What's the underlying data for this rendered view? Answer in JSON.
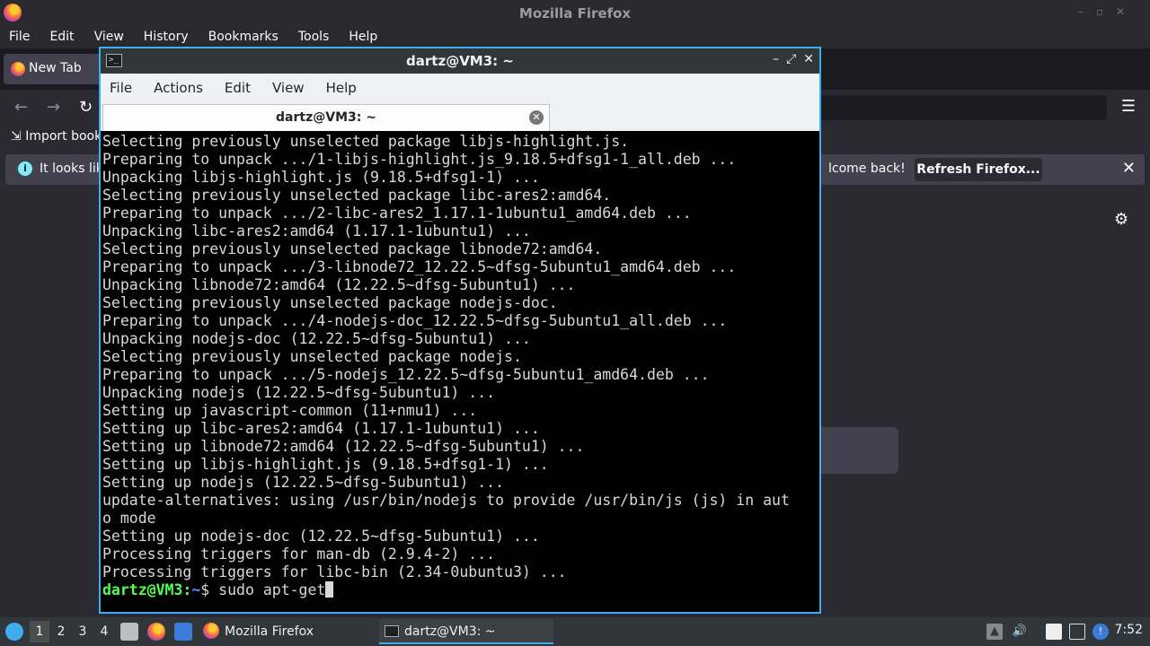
{
  "firefox": {
    "window_title": "Mozilla Firefox",
    "menu": [
      "File",
      "Edit",
      "View",
      "History",
      "Bookmarks",
      "Tools",
      "Help"
    ],
    "tab_label": "New Tab",
    "bookmarks_item": "Import book",
    "notice_left": "It looks lik",
    "notice_right": "lcome back!",
    "refresh_button": "Refresh Firefox..."
  },
  "terminal": {
    "window_title": "dartz@VM3: ~",
    "menu": [
      "File",
      "Actions",
      "Edit",
      "View",
      "Help"
    ],
    "tab_label": "dartz@VM3: ~",
    "lines": [
      "Selecting previously unselected package libjs-highlight.js.",
      "Preparing to unpack .../1-libjs-highlight.js_9.18.5+dfsg1-1_all.deb ...",
      "Unpacking libjs-highlight.js (9.18.5+dfsg1-1) ...",
      "Selecting previously unselected package libc-ares2:amd64.",
      "Preparing to unpack .../2-libc-ares2_1.17.1-1ubuntu1_amd64.deb ...",
      "Unpacking libc-ares2:amd64 (1.17.1-1ubuntu1) ...",
      "Selecting previously unselected package libnode72:amd64.",
      "Preparing to unpack .../3-libnode72_12.22.5~dfsg-5ubuntu1_amd64.deb ...",
      "Unpacking libnode72:amd64 (12.22.5~dfsg-5ubuntu1) ...",
      "Selecting previously unselected package nodejs-doc.",
      "Preparing to unpack .../4-nodejs-doc_12.22.5~dfsg-5ubuntu1_all.deb ...",
      "Unpacking nodejs-doc (12.22.5~dfsg-5ubuntu1) ...",
      "Selecting previously unselected package nodejs.",
      "Preparing to unpack .../5-nodejs_12.22.5~dfsg-5ubuntu1_amd64.deb ...",
      "Unpacking nodejs (12.22.5~dfsg-5ubuntu1) ...",
      "Setting up javascript-common (11+nmu1) ...",
      "Setting up libc-ares2:amd64 (1.17.1-1ubuntu1) ...",
      "Setting up libnode72:amd64 (12.22.5~dfsg-5ubuntu1) ...",
      "Setting up libjs-highlight.js (9.18.5+dfsg1-1) ...",
      "Setting up nodejs (12.22.5~dfsg-5ubuntu1) ...",
      "update-alternatives: using /usr/bin/nodejs to provide /usr/bin/js (js) in aut",
      "o mode",
      "Setting up nodejs-doc (12.22.5~dfsg-5ubuntu1) ...",
      "Processing triggers for man-db (2.9.4-2) ...",
      "Processing triggers for libc-bin (2.34-0ubuntu3) ..."
    ],
    "prompt_user": "dartz@VM3",
    "prompt_sep": ":",
    "prompt_path": "~",
    "prompt_symbol": "$ ",
    "command": "sudo apt-get"
  },
  "taskbar": {
    "workspaces": [
      "1",
      "2",
      "3",
      "4"
    ],
    "task_firefox": "Mozilla Firefox",
    "task_terminal": "dartz@VM3: ~",
    "clock": "7:52"
  }
}
